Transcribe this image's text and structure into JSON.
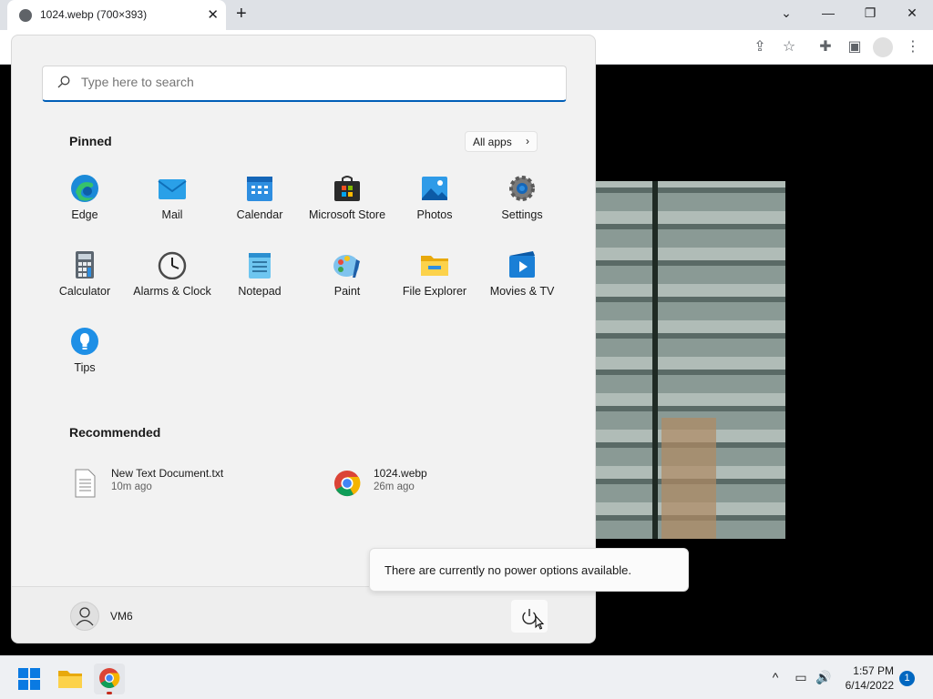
{
  "browser": {
    "tab_title": "1024.webp (700×393)",
    "new_tab_symbol": "+",
    "close_symbol": "✕",
    "window_controls": {
      "dropdown": "⌄",
      "minimize": "—",
      "restore": "❐",
      "close": "✕"
    },
    "toolbar_icons": [
      "share-icon",
      "star-icon",
      "extensions-icon",
      "sidepanel-icon",
      "profile-icon",
      "menu-icon"
    ]
  },
  "start_menu": {
    "search_placeholder": "Type here to search",
    "pinned_title": "Pinned",
    "all_apps_label": "All apps",
    "pinned_apps": [
      {
        "label": "Edge",
        "icon": "edge-icon"
      },
      {
        "label": "Mail",
        "icon": "mail-icon"
      },
      {
        "label": "Calendar",
        "icon": "calendar-icon"
      },
      {
        "label": "Microsoft Store",
        "icon": "store-icon"
      },
      {
        "label": "Photos",
        "icon": "photos-icon"
      },
      {
        "label": "Settings",
        "icon": "gear-icon"
      },
      {
        "label": "Calculator",
        "icon": "calculator-icon"
      },
      {
        "label": "Alarms & Clock",
        "icon": "clock-icon"
      },
      {
        "label": "Notepad",
        "icon": "notepad-icon"
      },
      {
        "label": "Paint",
        "icon": "paint-icon"
      },
      {
        "label": "File Explorer",
        "icon": "folder-icon"
      },
      {
        "label": "Movies & TV",
        "icon": "movies-icon"
      },
      {
        "label": "Tips",
        "icon": "lightbulb-icon"
      }
    ],
    "recommended_title": "Recommended",
    "recommended": [
      {
        "name": "New Text Document.txt",
        "time": "10m ago",
        "icon": "text-file-icon"
      },
      {
        "name": "1024.webp",
        "time": "26m ago",
        "icon": "chrome-icon"
      }
    ],
    "user_name": "VM6",
    "power_tooltip": "There are currently no power options available."
  },
  "taskbar": {
    "apps": [
      "windows-start-icon",
      "file-explorer-icon",
      "chrome-icon"
    ],
    "clock_time": "1:57 PM",
    "clock_date": "6/14/2022",
    "notification_count": "1",
    "tray_overflow": "^",
    "colors": {
      "accent": "#0067c0",
      "focus_line": "#005fb8"
    }
  }
}
